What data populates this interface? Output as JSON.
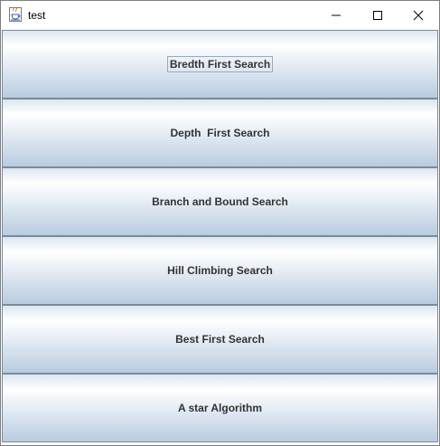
{
  "window": {
    "title": "test",
    "icon": "java-coffee-cup-icon",
    "controls": [
      "minimize-icon",
      "maximize-icon",
      "close-icon"
    ]
  },
  "buttons": [
    {
      "label": "Bredth First Search",
      "focused": true
    },
    {
      "label": "Depth  First Search",
      "focused": false
    },
    {
      "label": "Branch and Bound Search",
      "focused": false
    },
    {
      "label": "Hill Climbing Search",
      "focused": false
    },
    {
      "label": "Best First Search",
      "focused": false
    },
    {
      "label": "A star Algorithm",
      "focused": false
    }
  ],
  "colors": {
    "button_border": "#7a8a99",
    "button_gradient_top": "#ffffff",
    "button_gradient_bottom": "#b8cce0",
    "label_text": "#333333"
  }
}
